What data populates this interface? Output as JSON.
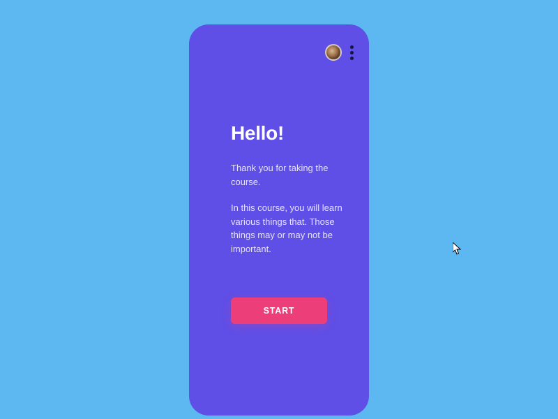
{
  "greeting": {
    "title": "Hello!",
    "para1": "Thank you for taking the course.",
    "para2": "In this course, you will learn various things that. Those things may or may not be important."
  },
  "button": {
    "start_label": "START"
  },
  "icons": {
    "avatar": "avatar",
    "more": "more-vertical-icon"
  },
  "colors": {
    "background": "#5db8f2",
    "card": "#5f4fe7",
    "accent": "#ec3f79"
  }
}
